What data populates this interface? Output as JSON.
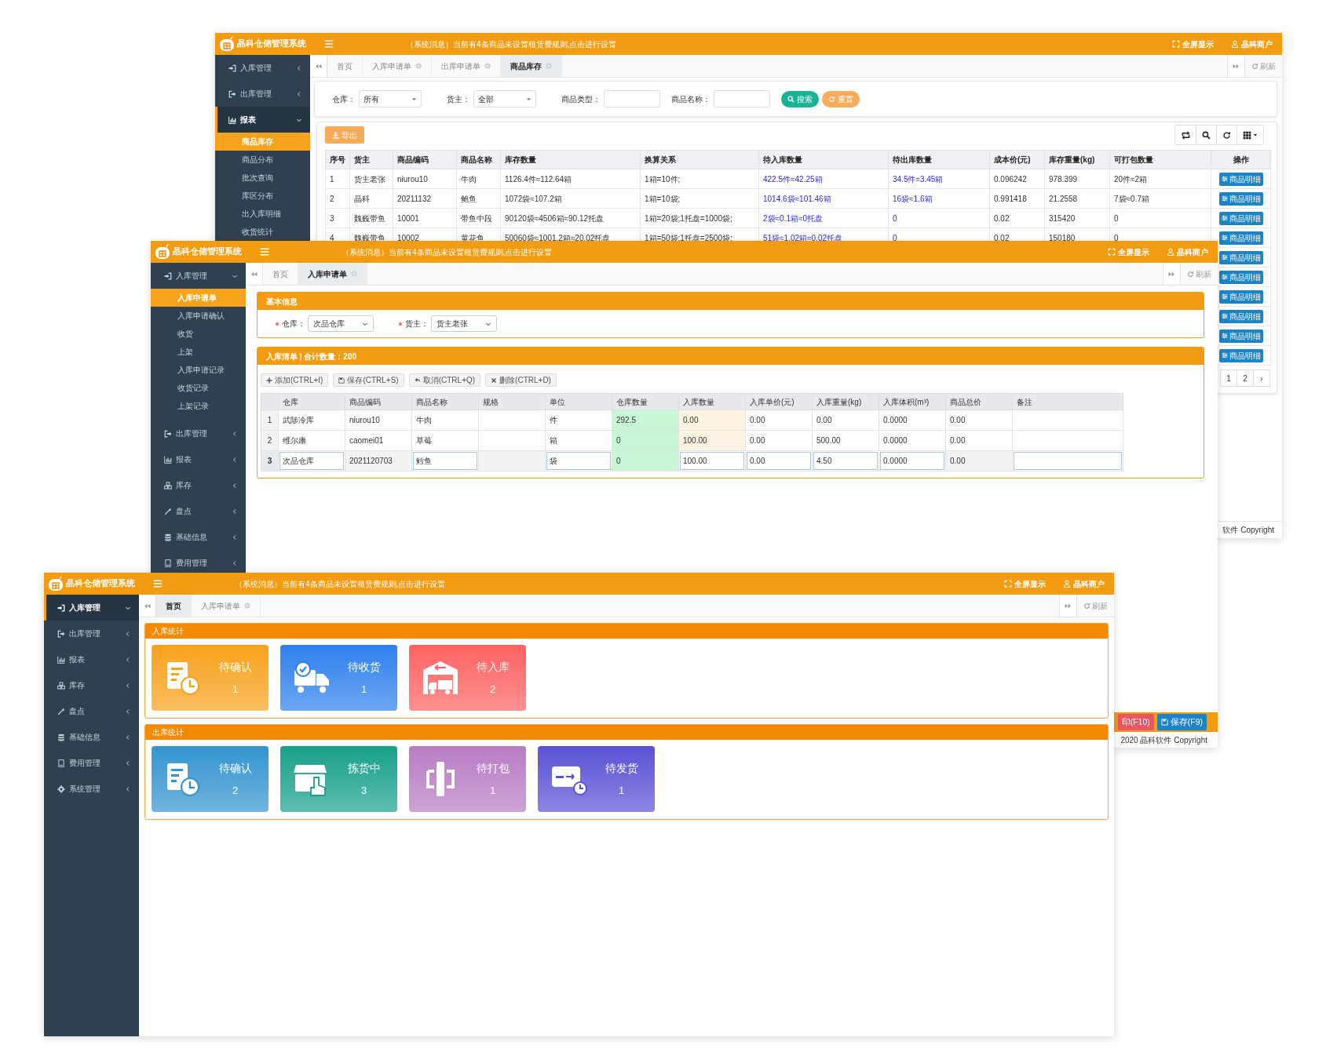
{
  "inventory_window": {
    "header": {
      "brand": "晶科仓储管理系统",
      "message": "（系统消息）当前有4条商品未设置租赁费规则,点击进行设置",
      "fullscreen": "全屏显示",
      "user": "晶科商户"
    },
    "sidebar": {
      "items": [
        {
          "label": "入库管理",
          "expanded": false,
          "selected": false
        },
        {
          "label": "出库管理",
          "expanded": false,
          "selected": false
        },
        {
          "label": "报表",
          "expanded": true,
          "selected": true,
          "children": [
            {
              "label": "商品库存",
              "selected": true
            },
            {
              "label": "商品分布",
              "selected": false
            },
            {
              "label": "批次查询",
              "selected": false
            },
            {
              "label": "库区分布",
              "selected": false
            },
            {
              "label": "出入库明细",
              "selected": false
            },
            {
              "label": "收货统计",
              "selected": false
            }
          ]
        }
      ]
    },
    "tabs": [
      {
        "label": "首页",
        "selected": false,
        "closable": false
      },
      {
        "label": "入库申请单",
        "selected": false,
        "closable": true
      },
      {
        "label": "出库申请单",
        "selected": false,
        "closable": true
      },
      {
        "label": "商品库存",
        "selected": true,
        "closable": true
      }
    ],
    "refresh": "刷新",
    "filters": [
      {
        "kind": "select",
        "label": "仓库：",
        "value": "所有"
      },
      {
        "kind": "select",
        "label": "货主：",
        "value": "全部"
      },
      {
        "kind": "input",
        "label": "商品类型："
      },
      {
        "kind": "input",
        "label": "商品名称："
      }
    ],
    "filter_buttons": [
      {
        "kind": "search",
        "label": "搜索"
      },
      {
        "kind": "reset",
        "label": "重置"
      }
    ],
    "export": "导出",
    "table": {
      "columns": [
        {
          "label": "序号",
          "kind": "text"
        },
        {
          "label": "货主",
          "kind": "text"
        },
        {
          "label": "商品编码",
          "kind": "text"
        },
        {
          "label": "商品名称",
          "kind": "text"
        },
        {
          "label": "库存数量",
          "kind": "text"
        },
        {
          "label": "换算关系",
          "kind": "text"
        },
        {
          "label": "待入库数量",
          "kind": "link"
        },
        {
          "label": "待出库数量",
          "kind": "link"
        },
        {
          "label": "成本价(元)",
          "kind": "text"
        },
        {
          "label": "库存重量(kg)",
          "kind": "text"
        },
        {
          "label": "可打包数量",
          "kind": "text"
        },
        {
          "label": "操作",
          "kind": "action"
        }
      ],
      "rows": [
        {
          "cells": [
            "1",
            "货主老张",
            "niurou10",
            "牛肉",
            "1126.4件≈112.64箱",
            "1箱=10件;",
            "422.5件≈42.25箱",
            "34.5件≈3.45箱",
            "0.096242",
            "978.399",
            "20件≈2箱"
          ],
          "action": "商品明细"
        },
        {
          "cells": [
            "2",
            "晶科",
            "20211132",
            "鲍鱼",
            "1072袋≈107.2箱",
            "1箱=10袋;",
            "1014.6袋≈101.46箱",
            "16袋≈1.6箱",
            "0.991418",
            "21.2558",
            "7袋≈0.7箱"
          ],
          "action": "商品明细"
        },
        {
          "cells": [
            "3",
            "魏巍带鱼",
            "10001",
            "带鱼中段",
            "90120袋≈4506箱≈90.12托盘",
            "1箱=20袋;1托盘=1000袋;",
            "2袋≈0.1箱≈0托盘",
            "0",
            "0.02",
            "315420",
            "0"
          ],
          "action": "商品明细"
        },
        {
          "cells": [
            "4",
            "魏巍带鱼",
            "10002",
            "黄花鱼",
            "50060袋≈1001.2箱≈20.02托盘",
            "1箱=50袋;1托盘=2500袋;",
            "51袋≈1.02箱≈0.02托盘",
            "0",
            "0.02",
            "150180",
            "0"
          ],
          "action": "商品明细"
        },
        {
          "action": "商品明细"
        },
        {
          "action": "商品明细"
        },
        {
          "action": "商品明细"
        },
        {
          "action": "商品明细"
        },
        {
          "action": "商品明细"
        },
        {
          "action": "商品明细"
        }
      ]
    },
    "pagination": [
      "1",
      "2",
      "›"
    ],
    "footer": "软件 Copyright"
  },
  "inbound_window": {
    "header": {
      "brand": "晶科仓储管理系统",
      "message": "（系统消息）当前有4条商品未设置租赁费规则,点击进行设置",
      "fullscreen": "全屏显示",
      "user": "晶科商户"
    },
    "sidebar": {
      "items": [
        {
          "label": "入库管理",
          "expanded": true,
          "selected": false,
          "children": [
            {
              "label": "入库申请单",
              "selected": true
            },
            {
              "label": "入库申请确认",
              "selected": false
            },
            {
              "label": "收货",
              "selected": false
            },
            {
              "label": "上架",
              "selected": false
            },
            {
              "label": "入库申请记录",
              "selected": false
            },
            {
              "label": "收货记录",
              "selected": false
            },
            {
              "label": "上架记录",
              "selected": false
            }
          ]
        },
        {
          "label": "出库管理",
          "expanded": false,
          "selected": false
        },
        {
          "label": "报表",
          "expanded": false,
          "selected": false
        },
        {
          "label": "库存",
          "expanded": false,
          "selected": false
        },
        {
          "label": "盘点",
          "expanded": false,
          "selected": false
        },
        {
          "label": "基础信息",
          "expanded": false,
          "selected": false
        },
        {
          "label": "费用管理",
          "expanded": false,
          "selected": false
        }
      ]
    },
    "tabs": [
      {
        "label": "首页",
        "selected": false,
        "closable": false
      },
      {
        "label": "入库申请单",
        "selected": true,
        "closable": true
      }
    ],
    "refresh": "刷新",
    "basic_panel": {
      "title": "基本信息",
      "fields": [
        {
          "required": true,
          "label": "仓库：",
          "value": "次品仓库"
        },
        {
          "required": true,
          "label": "货主：",
          "value": "货主老张"
        }
      ]
    },
    "list_panel": {
      "title": "入库清单 | 合计数量：200",
      "buttons": [
        "添加(CTRL+I)",
        "保存(CTRL+S)",
        "取消(CTRL+Q)",
        "删除(CTRL+D)"
      ],
      "table": {
        "columns": [
          {
            "label": "仓库",
            "kind": "plain",
            "editable": true
          },
          {
            "label": "商品编码",
            "kind": "plain",
            "editable": false
          },
          {
            "label": "商品名称",
            "kind": "plain",
            "editable": true
          },
          {
            "label": "规格",
            "kind": "plain",
            "editable": false
          },
          {
            "label": "单位",
            "kind": "plain",
            "editable": true
          },
          {
            "label": "仓库数量",
            "kind": "stock",
            "editable": false
          },
          {
            "label": "入库数量",
            "kind": "inbound",
            "editable": true
          },
          {
            "label": "入库单价(元)",
            "kind": "plain",
            "editable": true
          },
          {
            "label": "入库重量(kg)",
            "kind": "plain",
            "editable": true
          },
          {
            "label": "入库体积(m³)",
            "kind": "plain",
            "editable": true
          },
          {
            "label": "商品总价",
            "kind": "plain",
            "editable": false
          },
          {
            "label": "备注",
            "kind": "plain",
            "editable": true
          }
        ],
        "rows": [
          {
            "index": "1",
            "editing": false,
            "cells": [
              "武陟冷库",
              "niurou10",
              "牛肉",
              null,
              "件",
              "292.5",
              "0.00",
              "0.00",
              "0.00",
              "0.0000",
              "0.00",
              null
            ]
          },
          {
            "index": "2",
            "editing": false,
            "cells": [
              "维尔康",
              "caomei01",
              "草莓",
              null,
              "箱",
              "0",
              "100.00",
              "0.00",
              "500.00",
              "0.0000",
              "0.00",
              null
            ]
          },
          {
            "index": "3",
            "editing": true,
            "cells": [
              "次品仓库",
              "2021120703",
              "鳕鱼",
              null,
              "袋",
              "0",
              "100.00",
              "0.00",
              "4.50",
              "0.0000",
              "0.00",
              null
            ]
          }
        ]
      }
    },
    "footer_buttons": [
      {
        "kind": "print",
        "label": "印(F10)"
      },
      {
        "kind": "save",
        "label": "保存(F9)"
      }
    ],
    "copyright": "2020 晶科软件 Copyright"
  },
  "dashboard_window": {
    "header": {
      "brand": "晶科仓储管理系统",
      "message": "（系统消息）当前有4条商品未设置租赁费规则,点击进行设置",
      "fullscreen": "全屏显示",
      "user": "晶科商户"
    },
    "sidebar": {
      "items": [
        {
          "label": "入库管理",
          "expanded": true,
          "selected": true
        },
        {
          "label": "出库管理",
          "expanded": false,
          "selected": false
        },
        {
          "label": "报表",
          "expanded": false,
          "selected": false
        },
        {
          "label": "库存",
          "expanded": false,
          "selected": false
        },
        {
          "label": "盘点",
          "expanded": false,
          "selected": false
        },
        {
          "label": "基础信息",
          "expanded": false,
          "selected": false
        },
        {
          "label": "费用管理",
          "expanded": false,
          "selected": false
        },
        {
          "label": "系统管理",
          "expanded": false,
          "selected": false
        }
      ]
    },
    "tabs": [
      {
        "label": "首页",
        "selected": true,
        "closable": false
      },
      {
        "label": "入库申请单",
        "selected": false,
        "closable": true
      }
    ],
    "refresh": "刷新",
    "panels": [
      {
        "title": "入库统计",
        "cards": [
          {
            "label": "待确认",
            "count": "1",
            "color": "#f8a21c"
          },
          {
            "label": "待收货",
            "count": "1",
            "color": "#2f80ed"
          },
          {
            "label": "待入库",
            "count": "2",
            "color": "#ff6262"
          }
        ]
      },
      {
        "title": "出库统计",
        "cards": [
          {
            "label": "待确认",
            "count": "2",
            "color": "#3494d0"
          },
          {
            "label": "拣货中",
            "count": "3",
            "color": "#18a08a"
          },
          {
            "label": "待打包",
            "count": "1",
            "color": "#b87cc4"
          },
          {
            "label": "待发货",
            "count": "1",
            "color": "#5a52d5"
          }
        ]
      }
    ]
  }
}
